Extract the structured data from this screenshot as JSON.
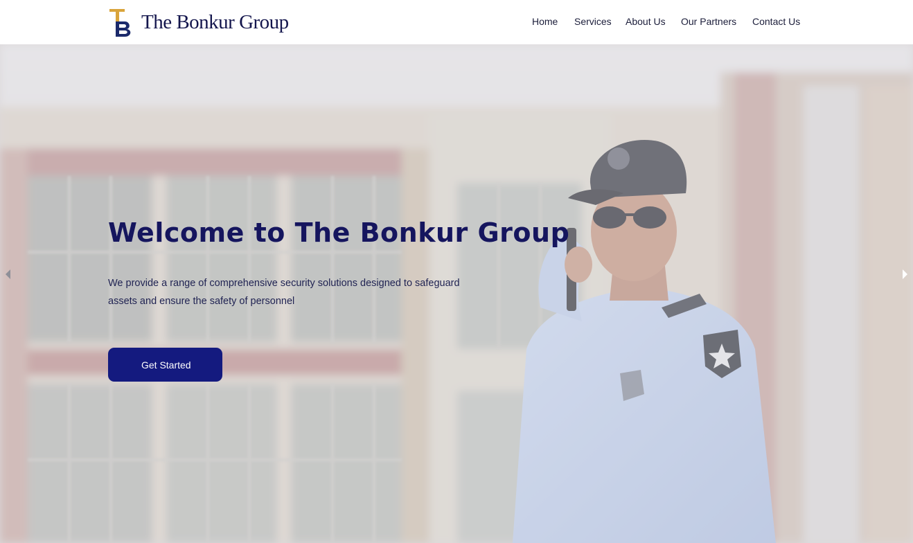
{
  "header": {
    "logo_text": "The Bonkur Group",
    "logo_colors": {
      "gold": "#d9a43b",
      "navy": "#1b2a6b"
    },
    "nav": [
      {
        "label": "Home"
      },
      {
        "label": "Services"
      },
      {
        "label": "About Us"
      },
      {
        "label": "Our Partners"
      },
      {
        "label": "Contact Us"
      }
    ]
  },
  "hero": {
    "title": "Welcome to The Bonkur Group",
    "description": "We provide a range of comprehensive security solutions designed to safeguard assets and ensure the safety of personnel",
    "cta_label": "Get Started",
    "prev_icon": "caret-left-icon",
    "next_icon": "caret-right-icon",
    "image_subject": "security-guard-photo"
  },
  "colors": {
    "title": "#15155e",
    "cta_bg": "#141a7f",
    "nav_text": "#1b1d3a"
  }
}
